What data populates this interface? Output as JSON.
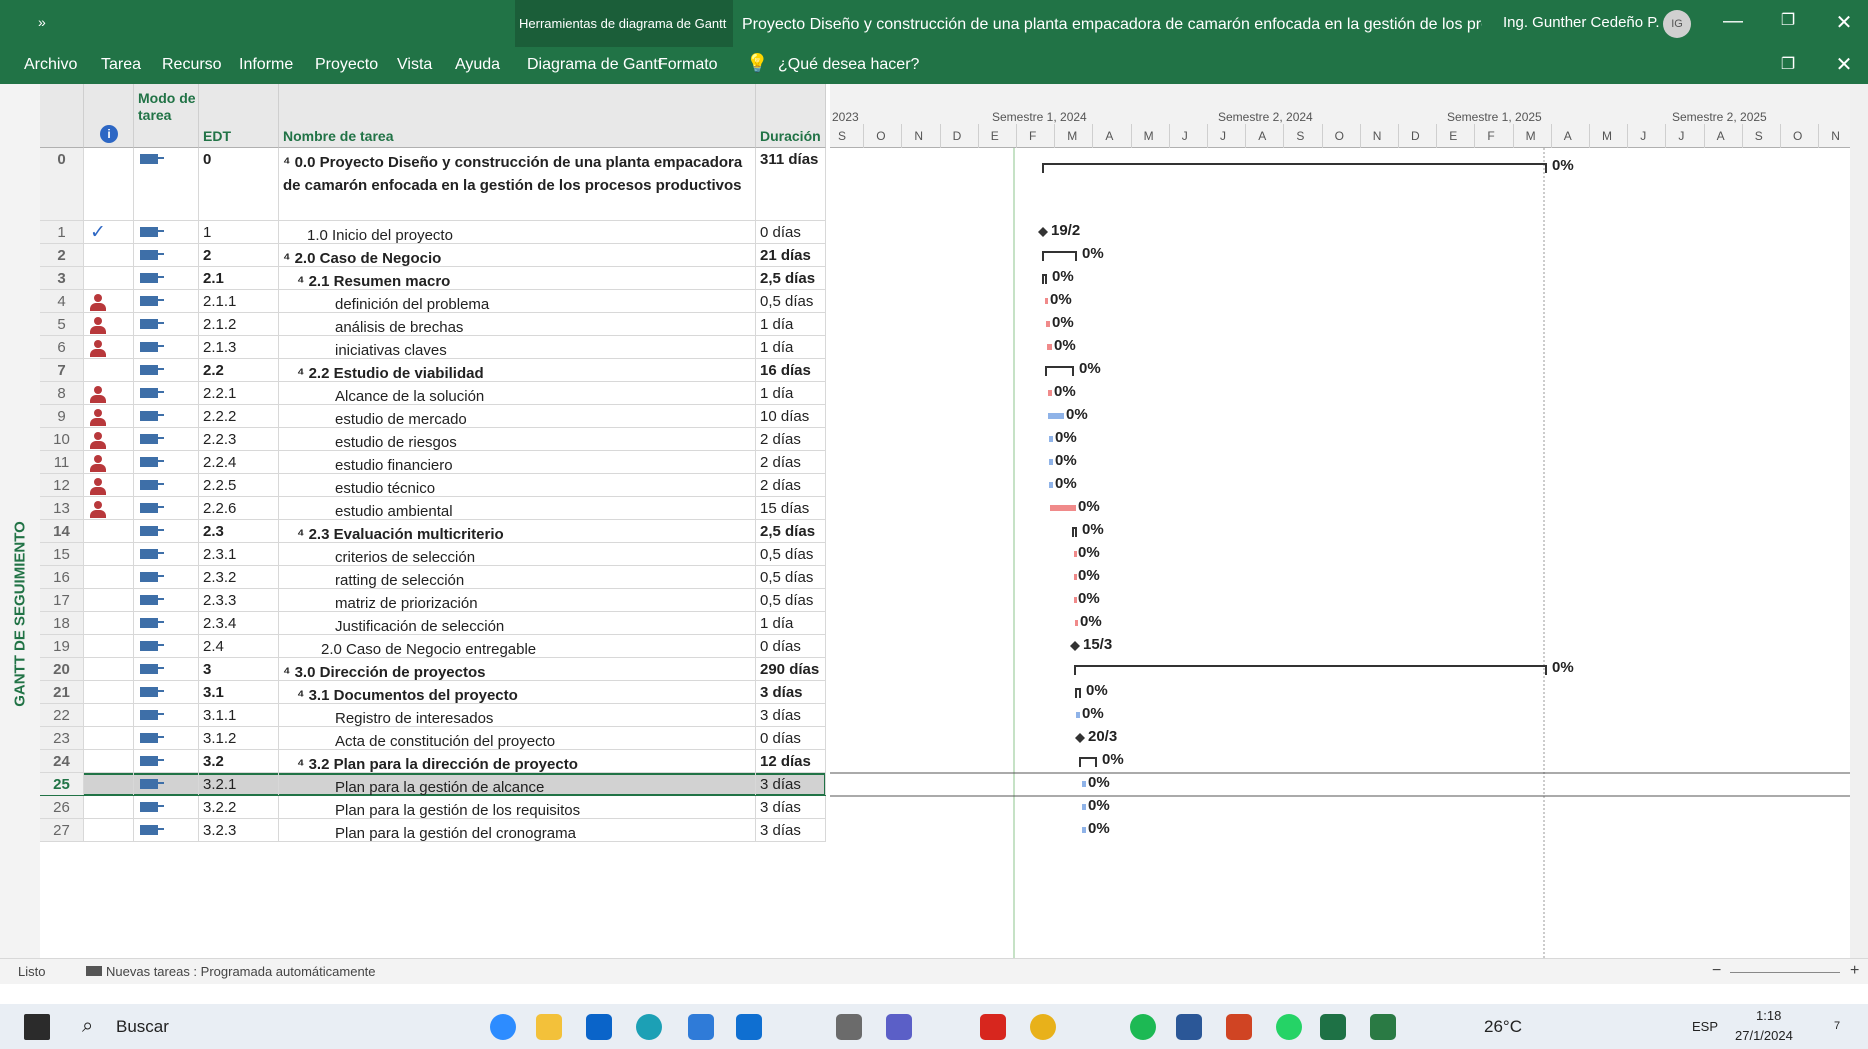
{
  "titlebar": {
    "quick_access": "»",
    "context_group": "Herramientas de diagrama de Gantt",
    "doc_title": "Proyecto Diseño y construcción de una planta empacadora de camarón enfocada en la gestión de los procesos...",
    "user_name": "Ing. Gunther Cedeño P.",
    "user_initials": "IG",
    "minimize": "—",
    "restore": "❐",
    "close": "✕"
  },
  "ribbon_tabs": [
    "Archivo",
    "Tarea",
    "Recurso",
    "Informe",
    "Proyecto",
    "Vista",
    "Ayuda",
    "Diagrama de Gantt",
    "Formato"
  ],
  "tell_me": "¿Qué desea hacer?",
  "side_label": "GANTT DE SEGUIMIENTO",
  "columns": {
    "indicators_icon": "i",
    "mode": "Modo de tarea",
    "wbs": "EDT",
    "name": "Nombre de tarea",
    "duration": "Duración"
  },
  "tasks": [
    {
      "id": "0",
      "ind": "",
      "wbs": "0",
      "name": "⁴ 0.0 Proyecto Diseño y construcción de una planta empacadora de camarón enfocada en la gestión de los procesos productivos",
      "dur": "311 días",
      "sum": true,
      "bar_label": "0%"
    },
    {
      "id": "1",
      "ind": "check",
      "wbs": "1",
      "name": "1.0 Inicio del proyecto",
      "dur": "0 días",
      "sum": false,
      "bar_label": "19/2"
    },
    {
      "id": "2",
      "ind": "",
      "wbs": "2",
      "name": "⁴ 2.0 Caso de Negocio",
      "dur": "21 días",
      "sum": true,
      "bar_label": "0%"
    },
    {
      "id": "3",
      "ind": "",
      "wbs": "2.1",
      "name": "⁴ 2.1 Resumen macro",
      "dur": "2,5 días",
      "sum": true,
      "bar_label": "0%"
    },
    {
      "id": "4",
      "ind": "person",
      "wbs": "2.1.1",
      "name": "definición del problema",
      "dur": "0,5 días",
      "sum": false,
      "bar_label": "0%"
    },
    {
      "id": "5",
      "ind": "person",
      "wbs": "2.1.2",
      "name": "análisis de brechas",
      "dur": "1 día",
      "sum": false,
      "bar_label": "0%"
    },
    {
      "id": "6",
      "ind": "person",
      "wbs": "2.1.3",
      "name": "iniciativas claves",
      "dur": "1 día",
      "sum": false,
      "bar_label": "0%"
    },
    {
      "id": "7",
      "ind": "",
      "wbs": "2.2",
      "name": "⁴ 2.2 Estudio de viabilidad",
      "dur": "16 días",
      "sum": true,
      "bar_label": "0%"
    },
    {
      "id": "8",
      "ind": "person",
      "wbs": "2.2.1",
      "name": "Alcance de la solución",
      "dur": "1 día",
      "sum": false,
      "bar_label": "0%"
    },
    {
      "id": "9",
      "ind": "person",
      "wbs": "2.2.2",
      "name": "estudio de mercado",
      "dur": "10 días",
      "sum": false,
      "bar_label": "0%"
    },
    {
      "id": "10",
      "ind": "person",
      "wbs": "2.2.3",
      "name": "estudio de riesgos",
      "dur": "2 días",
      "sum": false,
      "bar_label": "0%"
    },
    {
      "id": "11",
      "ind": "person",
      "wbs": "2.2.4",
      "name": "estudio financiero",
      "dur": "2 días",
      "sum": false,
      "bar_label": "0%"
    },
    {
      "id": "12",
      "ind": "person",
      "wbs": "2.2.5",
      "name": "estudio técnico",
      "dur": "2 días",
      "sum": false,
      "bar_label": "0%"
    },
    {
      "id": "13",
      "ind": "person",
      "wbs": "2.2.6",
      "name": "estudio ambiental",
      "dur": "15 días",
      "sum": false,
      "bar_label": "0%"
    },
    {
      "id": "14",
      "ind": "",
      "wbs": "2.3",
      "name": "⁴ 2.3 Evaluación multicriterio",
      "dur": "2,5 días",
      "sum": true,
      "bar_label": "0%"
    },
    {
      "id": "15",
      "ind": "",
      "wbs": "2.3.1",
      "name": "criterios de selección",
      "dur": "0,5 días",
      "sum": false,
      "bar_label": "0%"
    },
    {
      "id": "16",
      "ind": "",
      "wbs": "2.3.2",
      "name": "ratting de selección",
      "dur": "0,5 días",
      "sum": false,
      "bar_label": "0%"
    },
    {
      "id": "17",
      "ind": "",
      "wbs": "2.3.3",
      "name": "matriz de priorización",
      "dur": "0,5 días",
      "sum": false,
      "bar_label": "0%"
    },
    {
      "id": "18",
      "ind": "",
      "wbs": "2.3.4",
      "name": "Justificación de selección",
      "dur": "1 día",
      "sum": false,
      "bar_label": "0%"
    },
    {
      "id": "19",
      "ind": "",
      "wbs": "2.4",
      "name": "2.0 Caso de Negocio entregable",
      "dur": "0 días",
      "sum": false,
      "bar_label": "15/3"
    },
    {
      "id": "20",
      "ind": "",
      "wbs": "3",
      "name": "⁴ 3.0 Dirección de proyectos",
      "dur": "290 días",
      "sum": true,
      "bar_label": "0%"
    },
    {
      "id": "21",
      "ind": "",
      "wbs": "3.1",
      "name": "⁴ 3.1 Documentos del proyecto",
      "dur": "3 días",
      "sum": true,
      "bar_label": "0%"
    },
    {
      "id": "22",
      "ind": "",
      "wbs": "3.1.1",
      "name": "Registro de interesados",
      "dur": "3 días",
      "sum": false,
      "bar_label": "0%"
    },
    {
      "id": "23",
      "ind": "",
      "wbs": "3.1.2",
      "name": "Acta de constitución del proyecto",
      "dur": "0 días",
      "sum": false,
      "bar_label": "20/3"
    },
    {
      "id": "24",
      "ind": "",
      "wbs": "3.2",
      "name": "⁴ 3.2 Plan para la dirección de proyecto",
      "dur": "12 días",
      "sum": true,
      "bar_label": "0%"
    },
    {
      "id": "25",
      "ind": "",
      "wbs": "3.2.1",
      "name": "Plan para la gestión de alcance",
      "dur": "3 días",
      "sum": false,
      "bar_label": "0%",
      "selected": true
    },
    {
      "id": "26",
      "ind": "",
      "wbs": "3.2.2",
      "name": "Plan para la gestión de los requisitos",
      "dur": "3 días",
      "sum": false,
      "bar_label": "0%"
    },
    {
      "id": "27",
      "ind": "",
      "wbs": "3.2.3",
      "name": "Plan para la gestión del cronograma",
      "dur": "3 días",
      "sum": false,
      "bar_label": "0%"
    }
  ],
  "timescale": {
    "tiers": [
      "2023",
      "Semestre 1, 2024",
      "Semestre 2, 2024",
      "Semestre 1, 2025",
      "Semestre 2, 2025"
    ],
    "months": [
      "S",
      "O",
      "N",
      "D",
      "E",
      "F",
      "M",
      "A",
      "M",
      "J",
      "J",
      "A",
      "S",
      "O",
      "N",
      "D",
      "E",
      "F",
      "M",
      "A",
      "M",
      "J",
      "J",
      "A",
      "S",
      "O",
      "N"
    ]
  },
  "status": {
    "ready": "Listo",
    "new_tasks": "Nuevas tareas : Programada automáticamente",
    "zoom_minus": "−",
    "zoom_plus": "+"
  },
  "taskbar": {
    "search": "Buscar",
    "weather": "26°C",
    "lang": "ESP",
    "time": "1:18",
    "date": "27/1/2024",
    "notif_count": "7"
  },
  "colors": {
    "accent": "#217346",
    "gantt_critical": "#f08a8a",
    "gantt_task": "#8fb3e8",
    "summary": "#333333"
  }
}
